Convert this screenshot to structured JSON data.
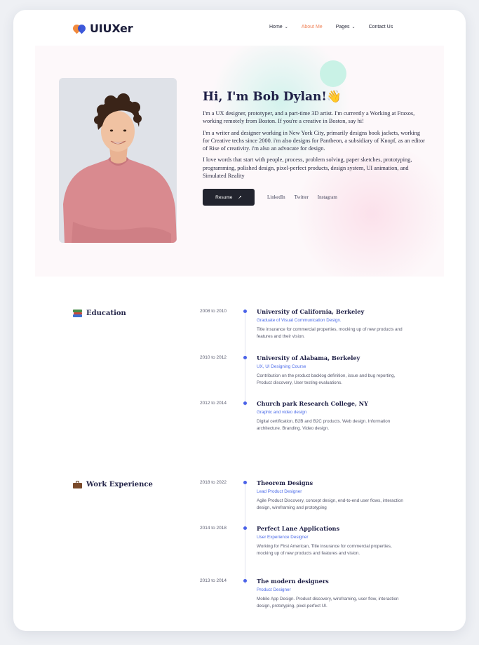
{
  "brand": {
    "name": "UIUXer"
  },
  "nav": {
    "items": [
      {
        "label": "Home",
        "has_dropdown": true,
        "active": false
      },
      {
        "label": "About Me",
        "has_dropdown": false,
        "active": true
      },
      {
        "label": "Pages",
        "has_dropdown": true,
        "active": false
      },
      {
        "label": "Contact Us",
        "has_dropdown": false,
        "active": false
      }
    ]
  },
  "hero": {
    "title": "Hi, I'm Bob Dylan!",
    "wave_emoji": "👋",
    "paragraphs": [
      "I'm a UX designer, prototyper, and a part-time 3D artist. I'm currently a Working at Fraxos, working remotely from Boston. If you're a creative in Boston, say hi!",
      "I'm a writer and designer working in New York City, primarily designs book jackets, working for Creative techs since 2000. i'm also designs for Pantheon, a subsidiary of Knopf, as an editor of Rise of creativity. i'm also an advocate for design.",
      "I love words that start with people, process, problem solving, paper sketches, prototyping, programming, polished design, pixel-perfect products, design system, UI animation, and Simulated Reality"
    ],
    "resume_label": "Resume",
    "resume_icon": "arrow-up-right-icon",
    "socials": [
      "LinkedIn",
      "Twitter",
      "Instagram"
    ]
  },
  "education": {
    "heading": "Education",
    "icon": "books-icon",
    "items": [
      {
        "years": "2008 to 2010",
        "title": "University of California, Berkeley",
        "subtitle": "Graduate of Visual Communication Design.",
        "description": "Title insurance for commercial properties, mocking up of new products and features and their vision."
      },
      {
        "years": "2010 to 2012",
        "title": "University of Alabama, Berkeley",
        "subtitle": "UX, UI Designing Course",
        "description": "Contribution on the product backlog definition, issue and bug reporting, Product discovery, User testing evaluations."
      },
      {
        "years": "2012 to 2014",
        "title": "Church park Research College, NY",
        "subtitle": "Graphic and video design",
        "description": "Digital certification, B2B and B2C products. Web design. Information architecture. Branding. Video design."
      }
    ]
  },
  "work": {
    "heading": "Work Experience",
    "icon": "briefcase-icon",
    "items": [
      {
        "years": "2018 to 2022",
        "title": "Theorem Designs",
        "subtitle": "Lead Product Designer",
        "description": "Agile Product Discovery, concept design, end-to-end user flows, interaction design, wireframing and prototyping"
      },
      {
        "years": "2014 to 2018",
        "title": "Perfect Lane Applications",
        "subtitle": "User Experience Designer",
        "description": "Working for First American, Title insurance for commercial properties, mocking up of new products and features and vision."
      },
      {
        "years": "2013 to 2014",
        "title": "The modern designers",
        "subtitle": "Product Designer",
        "description": "Mobile App Design. Product discovery, wireframing, user flow, interaction design, prototyping, pixel-perfect UI."
      }
    ]
  },
  "colors": {
    "accent": "#4a62e8",
    "nav_active": "#f0845a",
    "dark_button": "#22242e"
  }
}
